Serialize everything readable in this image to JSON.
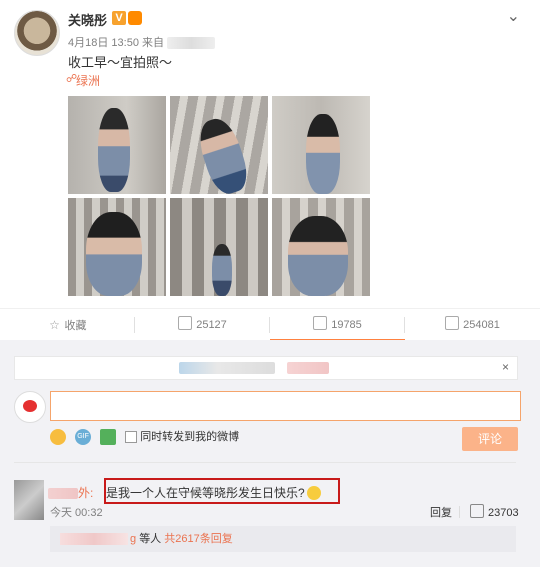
{
  "post": {
    "author": "关晓彤",
    "v_badge": "V",
    "time": "4月18日 13:50 来自",
    "text": "收工早～宜拍照～",
    "location": "绿洲"
  },
  "actions": {
    "favorite": "收藏",
    "repost": "25127",
    "comment": "19785",
    "like": "254081"
  },
  "composer": {
    "input_value": "",
    "sync_label": "同时转发到我的微博",
    "submit_label": "评论",
    "close": "×",
    "gif_label": "GIF"
  },
  "comment": {
    "name_suffix": "外:",
    "text": "是我一个人在守候等晓彤发生日快乐?",
    "time": "今天 00:32",
    "reply": "回复",
    "likes": "23703"
  },
  "subreplies": {
    "name_tail": "g",
    "others": "等人",
    "total": "共2617条回复"
  },
  "icons": {
    "location": "link-icon",
    "favorite": "star-icon",
    "repost": "repost-icon",
    "comment": "comment-icon",
    "like": "thumb-up-icon",
    "caret": "chevron-down-icon",
    "emoji": "emoji-icon",
    "gif": "gif-icon",
    "picture": "image-icon"
  },
  "colors": {
    "accent": "#eb7350",
    "highlight_box": "#c81a1a",
    "submit_disabled": "#fbb389"
  }
}
